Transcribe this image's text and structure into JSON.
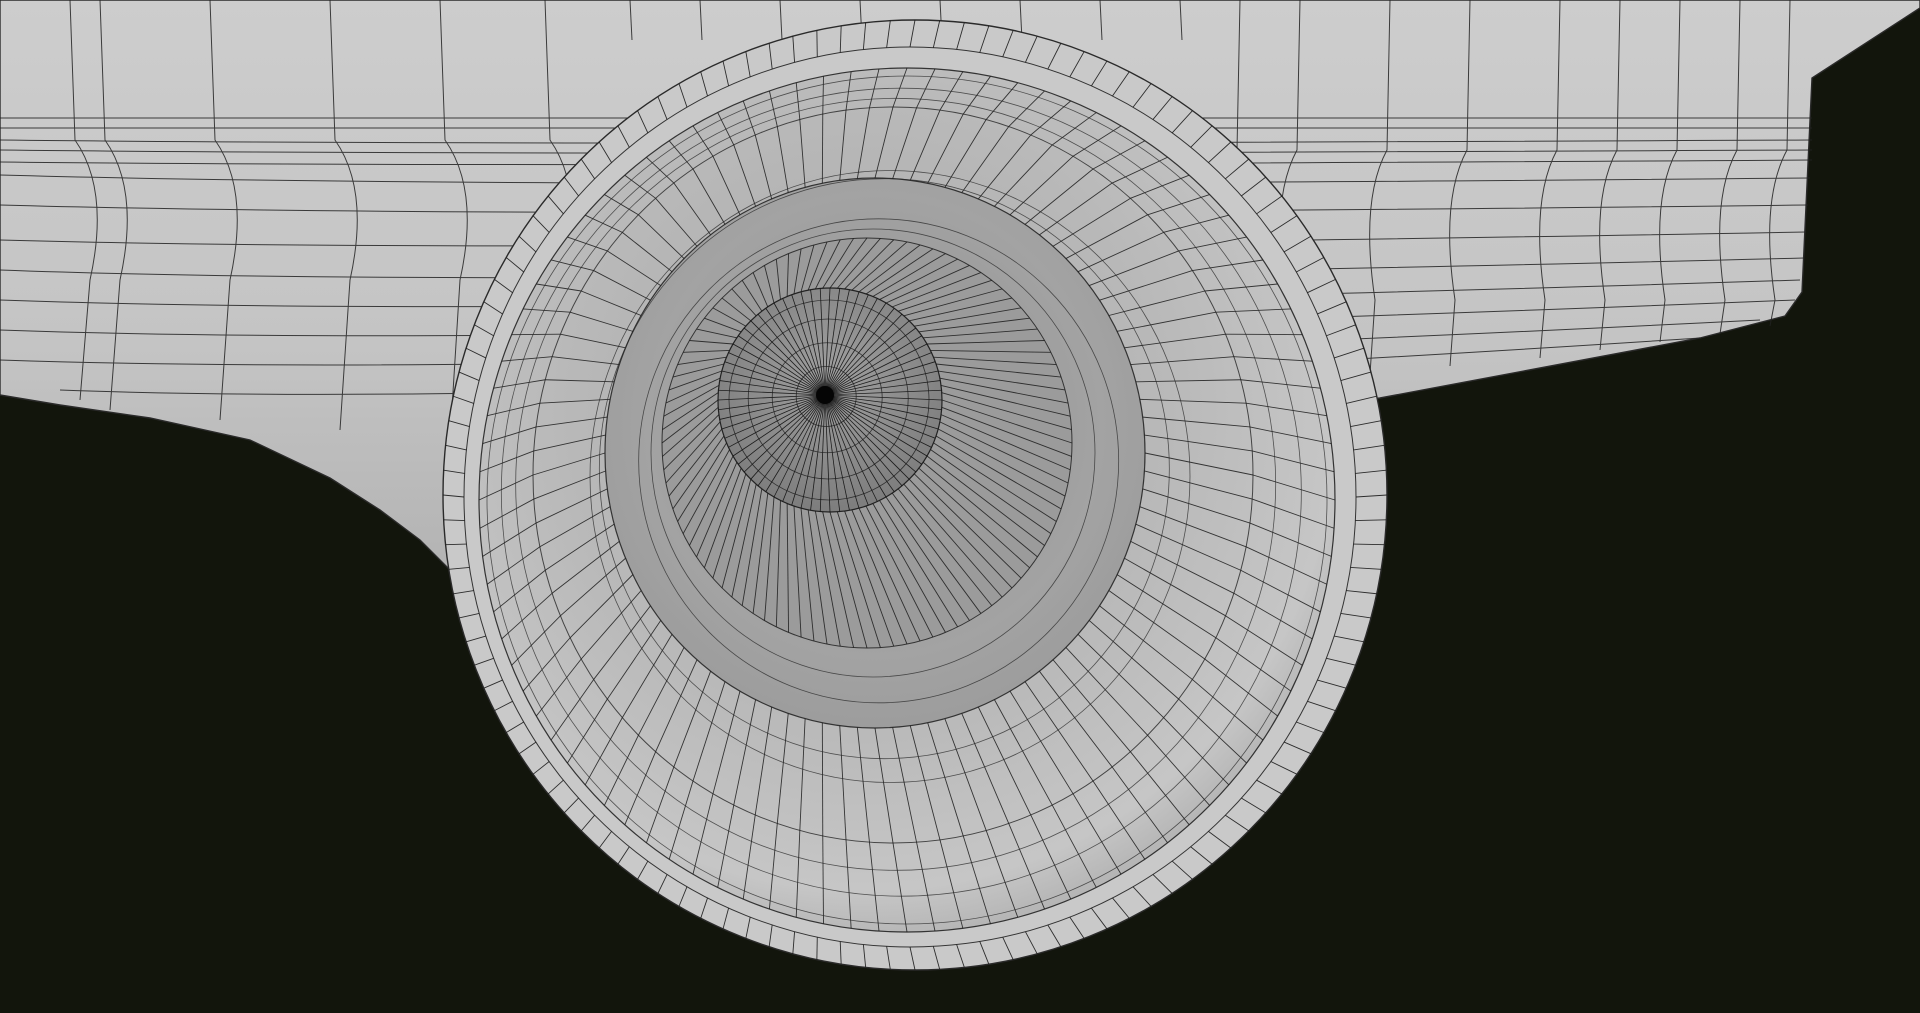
{
  "viewport": {
    "content": "3d-wireframe-render",
    "background_color": "#12150c",
    "surface_color": "#c9c9c9",
    "wire_color": "#1a1a1a"
  }
}
